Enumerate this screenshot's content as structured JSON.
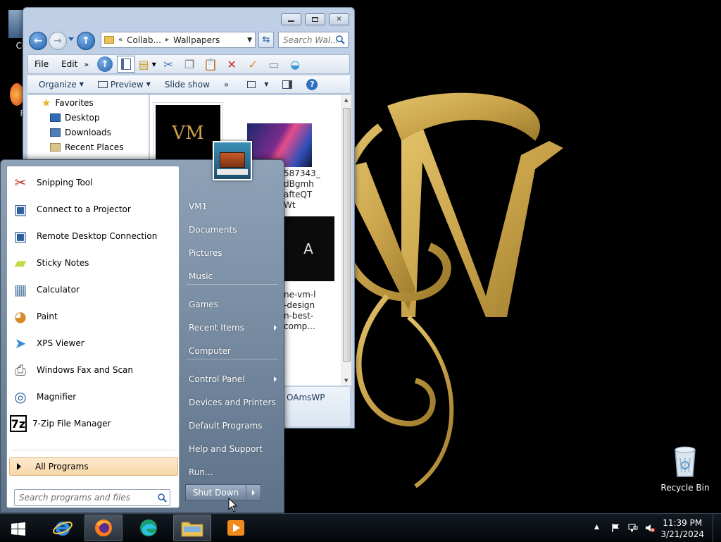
{
  "explorer": {
    "address_parts": [
      "Collab...",
      "Wallpapers"
    ],
    "search_placeholder": "Search Wal...",
    "menu": [
      "File",
      "Edit"
    ],
    "command_bar": {
      "organize": "Organize",
      "preview": "Preview",
      "slideshow": "Slide show",
      "more": "»"
    },
    "nav": [
      {
        "label": "Favorites",
        "icon": "star-icon"
      },
      {
        "label": "Desktop",
        "icon": "desktop-icon"
      },
      {
        "label": "Downloads",
        "icon": "downloads-icon"
      },
      {
        "label": "Recent Places",
        "icon": "recent-places-icon"
      }
    ],
    "files": [
      {
        "name_lines": [
          "587343_",
          "dBgmh",
          "afteQT",
          "Wt"
        ]
      },
      {
        "name_lines": [
          "ne-vm-l",
          "-design",
          "n-best-",
          "comp..."
        ]
      }
    ],
    "details_text": "OAmsWP"
  },
  "start_menu": {
    "programs": [
      {
        "label": "Snipping Tool",
        "icon": "snipping-tool-icon"
      },
      {
        "label": "Connect to a Projector",
        "icon": "projector-icon"
      },
      {
        "label": "Remote Desktop Connection",
        "icon": "remote-desktop-icon"
      },
      {
        "label": "Sticky Notes",
        "icon": "sticky-notes-icon"
      },
      {
        "label": "Calculator",
        "icon": "calculator-icon"
      },
      {
        "label": "Paint",
        "icon": "paint-icon"
      },
      {
        "label": "XPS Viewer",
        "icon": "xps-viewer-icon"
      },
      {
        "label": "Windows Fax and Scan",
        "icon": "fax-scan-icon"
      },
      {
        "label": "Magnifier",
        "icon": "magnifier-icon"
      },
      {
        "label": "7-Zip File Manager",
        "icon": "7zip-icon"
      }
    ],
    "all_programs": "All Programs",
    "search_placeholder": "Search programs and files",
    "right_links": [
      {
        "label": "VM1",
        "submenu": false
      },
      {
        "label": "Documents",
        "submenu": false
      },
      {
        "label": "Pictures",
        "submenu": false
      },
      {
        "label": "Music",
        "submenu": false
      },
      {
        "label": "Games",
        "submenu": false
      },
      {
        "label": "Recent Items",
        "submenu": true
      },
      {
        "label": "Computer",
        "submenu": false
      },
      {
        "label": "Control Panel",
        "submenu": true
      },
      {
        "label": "Devices and Printers",
        "submenu": false
      },
      {
        "label": "Default Programs",
        "submenu": false
      },
      {
        "label": "Help and Support",
        "submenu": false
      },
      {
        "label": "Run...",
        "submenu": false
      }
    ],
    "shutdown": "Shut Down"
  },
  "desktop": {
    "icons": [
      {
        "label": "Recycle Bin",
        "icon": "recycle-bin-icon"
      }
    ],
    "partial_labels": [
      "Cor",
      "Fi"
    ]
  },
  "taskbar": {
    "apps": [
      {
        "name": "internet-explorer",
        "active": false
      },
      {
        "name": "firefox",
        "active": true
      },
      {
        "name": "edge",
        "active": false
      },
      {
        "name": "file-explorer",
        "active": true
      },
      {
        "name": "media-player",
        "active": false
      }
    ],
    "time": "11:39 PM",
    "date": "3/21/2024"
  },
  "colors": {
    "wallpaper_gold": "#c9a34a",
    "start_menu_bg": "#6f8399",
    "all_programs_bg": "#f8d7a8"
  }
}
